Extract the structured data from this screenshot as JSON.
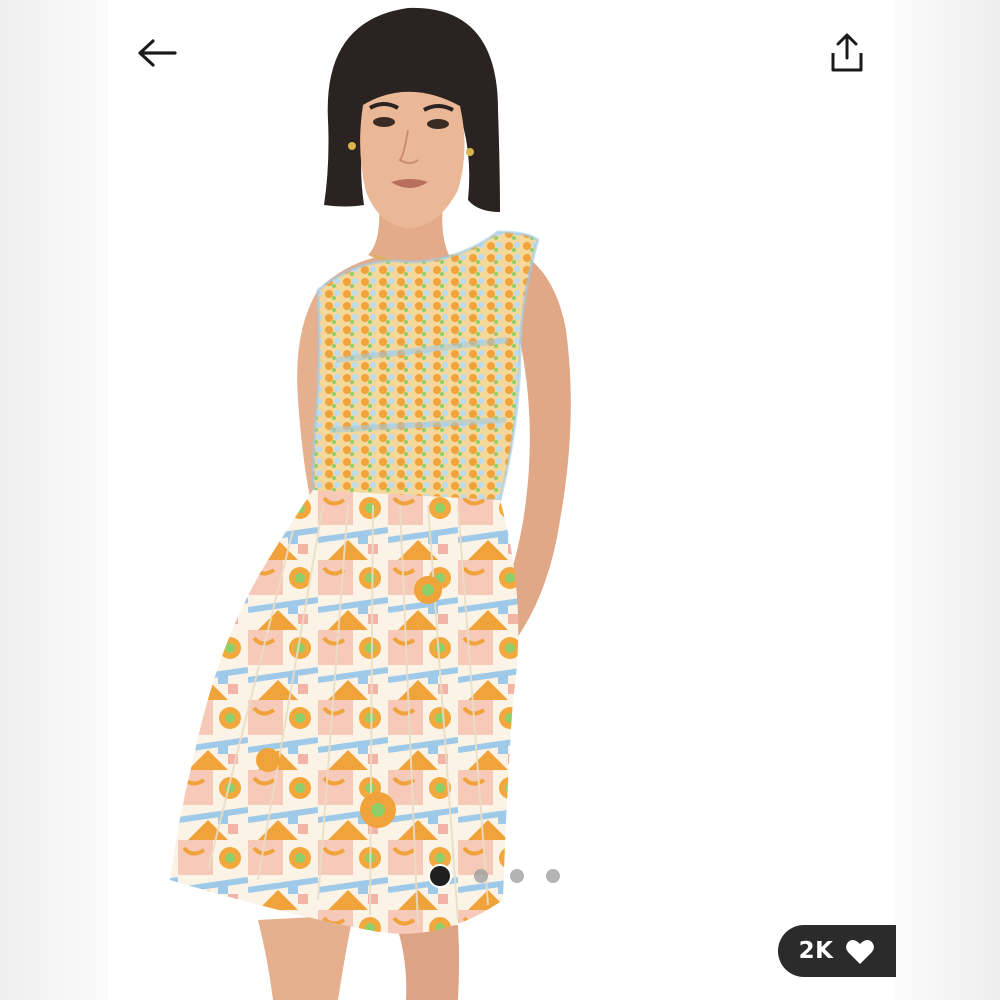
{
  "nav": {
    "back_icon": "arrow-left-icon",
    "share_icon": "share-upload-icon"
  },
  "gallery": {
    "image_subject": "product-photo-patterned-sleeveless-mini-dress",
    "total_images": 4,
    "active_index": 0
  },
  "likes": {
    "count": "2K",
    "icon": "heart-icon"
  },
  "colors": {
    "pill_background": "#2b2b2b",
    "dot_active": "#1f1f1f",
    "dot_inactive": "#9a9a9a",
    "print_orange": "#f0a33a",
    "print_blue": "#9ec9e8",
    "print_pink": "#f3b4a8",
    "print_green": "#8fcf6a"
  }
}
